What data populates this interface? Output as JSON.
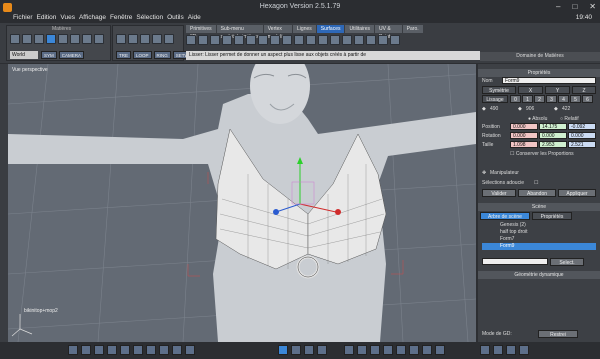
{
  "window": {
    "title": "Hexagon Version 2.5.1.79",
    "clock": "19:40"
  },
  "menu": [
    "Fichier",
    "Edition",
    "Vues",
    "Affichage",
    "Fenêtre",
    "Sélection",
    "Outils",
    "Aide"
  ],
  "toolbar": {
    "materials_label": "Matières",
    "space_select": "World",
    "space_btns": [
      "SYM",
      "CAMERA"
    ],
    "sym_btns": [
      "TRE",
      "LOOP",
      "RING",
      "SETW"
    ]
  },
  "tabs": [
    {
      "label": "Primitives 3D",
      "active": false
    },
    {
      "label": "Sub-menu sculpts/primitives",
      "active": false
    },
    {
      "label": "Vertex modeling",
      "active": false
    },
    {
      "label": "Lignes",
      "active": false
    },
    {
      "label": "Surfaces",
      "active": true
    },
    {
      "label": "Utilitaires",
      "active": false
    },
    {
      "label": "UV & Peinture",
      "active": false
    },
    {
      "label": "Paro.",
      "active": false
    }
  ],
  "status_hint": "Lisser: Lisser permet de donner un aspect plus lisse aux objets créés à partir de",
  "viewport": {
    "label": "Vue perspective",
    "bottom_label": "bikinitop+mop2"
  },
  "panel": {
    "domain_title": "Domaine de Matières",
    "props_title": "Propriétés",
    "name_label": "Nom",
    "name_value": "Form9",
    "symetrie": "Symétrie",
    "axes": [
      "X",
      "Y",
      "Z"
    ],
    "lissage": "Lissage",
    "lissage_vals": [
      "0",
      "1",
      "2",
      "3",
      "4",
      "5",
      "6"
    ],
    "counts": [
      "490",
      "906",
      "422"
    ],
    "absolu": "Absolu",
    "relatif": "Relatif",
    "position_label": "Position",
    "position": [
      "0.000",
      "14.175",
      "-0.092"
    ],
    "rotation_label": "Rotation",
    "rotation": [
      "0.000",
      "0.000",
      "0.000"
    ],
    "taille_label": "Taille",
    "taille": [
      "1.098",
      "2.953",
      "2.521"
    ],
    "keep_props": "Conserver les Proportions",
    "manip": "Manipulateur",
    "selection_softened": "Sélections adoucie",
    "validate": "Valider",
    "abandon": "Abandon",
    "apply": "Appliquer",
    "scene_title": "Scène",
    "scene_tabs": [
      "Arbre de scène",
      "Propriétés"
    ],
    "tree": [
      {
        "label": "Genesis (2)",
        "selected": false
      },
      {
        "label": "half top droit",
        "selected": false
      },
      {
        "label": "Form7",
        "selected": false
      },
      {
        "label": "Form9",
        "selected": true
      }
    ],
    "select_btn": "Select.",
    "geom_title": "Géométrie dynamique",
    "gd_mode_label": "Mode de GD:",
    "gd_mode_value": "Restrei"
  }
}
